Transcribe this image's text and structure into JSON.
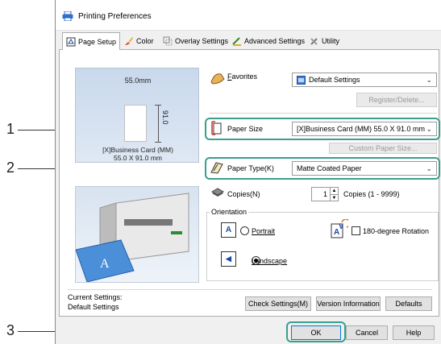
{
  "window": {
    "title": "Printing Preferences"
  },
  "tabs": [
    {
      "label": "Page Setup",
      "icon": "page-setup-icon"
    },
    {
      "label": "Color",
      "icon": "color-brush-icon"
    },
    {
      "label": "Overlay Settings",
      "icon": "overlay-icon"
    },
    {
      "label": "Advanced Settings",
      "icon": "advanced-settings-icon"
    },
    {
      "label": "Utility",
      "icon": "utility-icon"
    }
  ],
  "preview": {
    "width_label": "55.0mm",
    "height_label": "91.0",
    "paper_name_line1": "[X]Business Card (MM)",
    "paper_name_line2": "55.0 X 91.0 mm"
  },
  "favorites": {
    "label": "Favorites",
    "accesskey": "F",
    "value": "Default Settings",
    "register_button": "Register/Delete..."
  },
  "paper_size": {
    "label": "Paper Size",
    "value": "[X]Business Card (MM) 55.0 X 91.0 mm",
    "custom_button": "Custom Paper Size..."
  },
  "paper_type": {
    "label": "Paper Type(K)",
    "value": "Matte Coated Paper"
  },
  "copies": {
    "label": "Copies(N)",
    "value": "1",
    "range": "Copies (1 - 9999)"
  },
  "orientation": {
    "group_label": "Orientation",
    "portrait": "Portrait",
    "landscape": "Landscape",
    "rotate": "180-degree Rotation",
    "selected": "landscape",
    "rotate_checked": false
  },
  "current_settings": {
    "line1": "Current Settings:",
    "line2": "Default Settings"
  },
  "panel_buttons": {
    "check": "Check Settings(M)",
    "version": "Version Information",
    "defaults": "Defaults"
  },
  "dialog_buttons": {
    "ok": "OK",
    "cancel": "Cancel",
    "help": "Help"
  },
  "callouts": [
    "1",
    "2",
    "3"
  ],
  "colors": {
    "highlight": "#3a9f8c",
    "accent": "#1a48a8"
  }
}
